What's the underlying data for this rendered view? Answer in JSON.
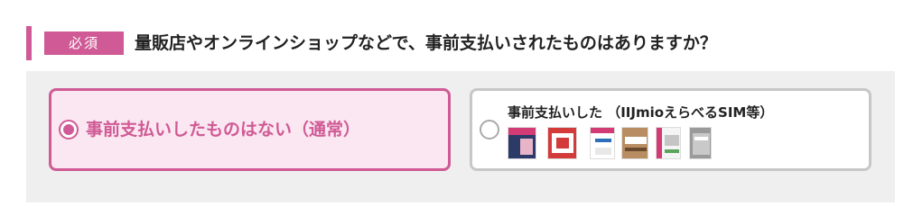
{
  "question": {
    "required_label": "必須",
    "text": "量販店やオンラインショップなどで、事前支払いされたものはありますか？"
  },
  "options": [
    {
      "label": "事前支払いしたものはない（通常）",
      "selected": true
    },
    {
      "label": "事前支払いした （IIJmioえらべるSIM等）",
      "selected": false,
      "images": [
        "package-icon-1",
        "package-icon-2",
        "package-icon-3",
        "package-icon-4",
        "package-icon-5",
        "package-icon-6"
      ]
    }
  ],
  "colors": {
    "accent": "#cf5a95",
    "panel_bg": "#efefef",
    "selected_bg": "#fbe7f1",
    "unselected_border": "#c7c7c7"
  }
}
